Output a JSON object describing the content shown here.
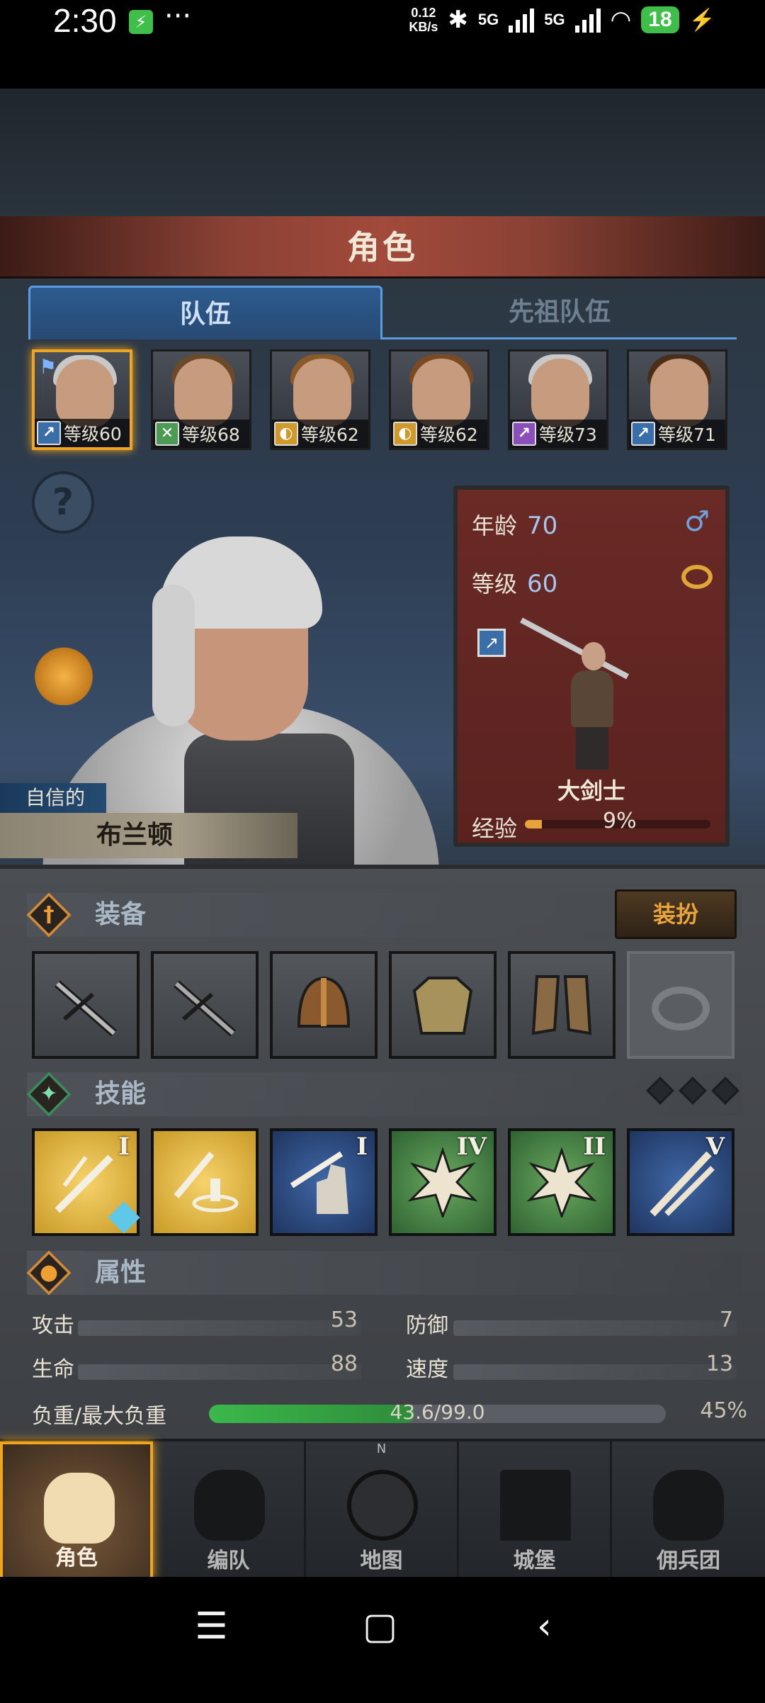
{
  "status_bar": {
    "time": "2:30",
    "charging_badge": "⚡",
    "more": "···",
    "speed_top": "0.12",
    "speed_unit": "KB/s",
    "sig1": "5G",
    "sig2": "5G",
    "battery": "18"
  },
  "header": {
    "title": "角色"
  },
  "tabs": {
    "team": "队伍",
    "ancestor_team": "先祖队伍"
  },
  "roster": [
    {
      "level": "等级60",
      "class_icon": "greatsword-icon",
      "selected": true
    },
    {
      "level": "等级68",
      "class_icon": "crossed-swords-icon"
    },
    {
      "level": "等级62",
      "class_icon": "shield-icon"
    },
    {
      "level": "等级62",
      "class_icon": "shield-icon"
    },
    {
      "level": "等级73",
      "class_icon": "staff-icon"
    },
    {
      "level": "等级71",
      "class_icon": "greatsword-icon"
    }
  ],
  "character": {
    "trait": "自信的",
    "name": "布兰顿",
    "age_label": "年龄",
    "age": "70",
    "level_label": "等级",
    "level": "60",
    "class_name": "大剑士",
    "exp_label": "经验",
    "exp_percent": "9%",
    "exp_fraction": 0.09
  },
  "equipment": {
    "title": "装备",
    "outfit_button": "装扮"
  },
  "skills": {
    "title": "技能",
    "items": [
      {
        "rank": "I",
        "color": "gold"
      },
      {
        "rank": "",
        "color": "gold"
      },
      {
        "rank": "I",
        "color": "blue"
      },
      {
        "rank": "IV",
        "color": "green"
      },
      {
        "rank": "II",
        "color": "green"
      },
      {
        "rank": "V",
        "color": "blue"
      }
    ],
    "gem_level": "1"
  },
  "attributes": {
    "title": "属性",
    "attack_label": "攻击",
    "attack": "53",
    "defense_label": "防御",
    "defense": "7",
    "hp_label": "生命",
    "hp": "88",
    "speed_label": "速度",
    "speed": "13",
    "load_label": "负重/最大负重",
    "load_value": "43.6/99.0",
    "load_percent": "45%",
    "load_fraction": 0.45
  },
  "nav": {
    "character": "角色",
    "formation": "编队",
    "map": "地图",
    "map_compass": "N",
    "castle": "城堡",
    "mercenary": "佣兵团"
  },
  "colors": {
    "accent_gold": "#f0a521",
    "tab_blue": "#5b9be0",
    "banner_red": "#a24a3b",
    "load_green": "#3bb84a"
  }
}
